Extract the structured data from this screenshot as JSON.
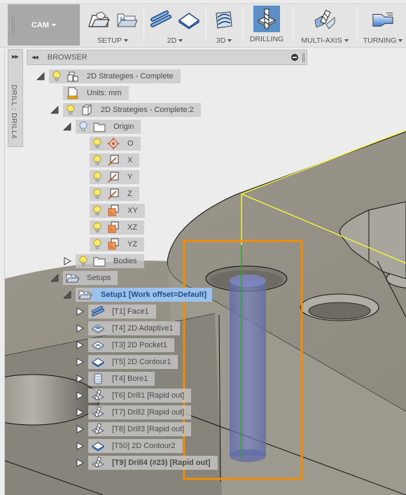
{
  "toolbar": {
    "workspace": "CAM",
    "groups": [
      {
        "label": "SETUP",
        "has_dropdown": true,
        "icons": [
          "new-setup-icon",
          "setup-folder-icon"
        ]
      },
      {
        "label": "2D",
        "has_dropdown": true,
        "icons": [
          "2d-face-icon",
          "2d-contour-icon"
        ]
      },
      {
        "label": "3D",
        "has_dropdown": true,
        "icons": [
          "3d-strategy-icon"
        ]
      },
      {
        "label": "DRILLING",
        "has_dropdown": false,
        "active": true,
        "icons": [
          "drill-icon"
        ]
      },
      {
        "label": "MULTI-AXIS",
        "has_dropdown": true,
        "icons": [
          "multi-axis-icon"
        ]
      },
      {
        "label": "TURNING",
        "has_dropdown": true,
        "icons": [
          "turning-icon"
        ]
      }
    ]
  },
  "left_tab": {
    "label": "DRILL : DRILL4"
  },
  "browser": {
    "title": "BROWSER",
    "tree": [
      {
        "label": "2D Strategies - Complete",
        "icon": "component-icon",
        "bulb": "on",
        "expanded": true
      },
      {
        "label": "Units: mm",
        "icon": "units-document-icon"
      },
      {
        "label": "2D Strategies - Complete:2",
        "icon": "body-cube-icon",
        "bulb": "on",
        "expanded": true
      },
      {
        "label": "Origin",
        "icon": "folder-icon",
        "bulb": "off",
        "expanded": true
      },
      {
        "label": "O",
        "icon": "origin-point-icon",
        "bulb": "on"
      },
      {
        "label": "X",
        "icon": "axis-icon",
        "bulb": "on"
      },
      {
        "label": "Y",
        "icon": "axis-icon",
        "bulb": "on"
      },
      {
        "label": "Z",
        "icon": "axis-icon",
        "bulb": "on"
      },
      {
        "label": "XY",
        "icon": "plane-icon",
        "bulb": "on"
      },
      {
        "label": "XZ",
        "icon": "plane-icon",
        "bulb": "on"
      },
      {
        "label": "YZ",
        "icon": "plane-icon",
        "bulb": "on"
      },
      {
        "label": "Bodies",
        "icon": "folder-icon",
        "bulb": "on",
        "expanded": false
      },
      {
        "label": "Setups",
        "icon": "setups-folder-icon",
        "expanded": true
      },
      {
        "label": "Setup1 [Work offset=Default]",
        "icon": "setup-icon",
        "expanded": true,
        "selected": true
      },
      {
        "label": "[T1] Face1",
        "icon": "face-op-icon",
        "expanded": false
      },
      {
        "label": "[T4] 2D Adaptive1",
        "icon": "adaptive-op-icon",
        "expanded": false
      },
      {
        "label": "[T3] 2D Pocket1",
        "icon": "pocket-op-icon",
        "expanded": false
      },
      {
        "label": "[T5] 2D Contour1",
        "icon": "contour-op-icon",
        "expanded": false
      },
      {
        "label": "[T4] Bore1",
        "icon": "bore-op-icon",
        "expanded": false
      },
      {
        "label": "[T6] Drill1 [Rapid out]",
        "icon": "drill-op-icon",
        "expanded": false
      },
      {
        "label": "[T7] Drill2 [Rapid out]",
        "icon": "drill-op-icon",
        "expanded": false
      },
      {
        "label": "[T8] Drill3 [Rapid out]",
        "icon": "drill-op-icon",
        "expanded": false
      },
      {
        "label": "[T50] 2D Contour2",
        "icon": "contour-op-icon",
        "expanded": false
      },
      {
        "label": "[T9] Drill4 (#23) [Rapid out]",
        "icon": "drill-op-icon",
        "expanded": false,
        "bold": true
      }
    ]
  },
  "colors": {
    "accent_active": "#5c8fc6",
    "selection": "#96c3f5",
    "highlight_box": "#f28c00",
    "stock_outline": "#ffff33",
    "tool_axis": "#22aa22",
    "tool_body": "#6b78b8",
    "part": "#9a968c"
  }
}
